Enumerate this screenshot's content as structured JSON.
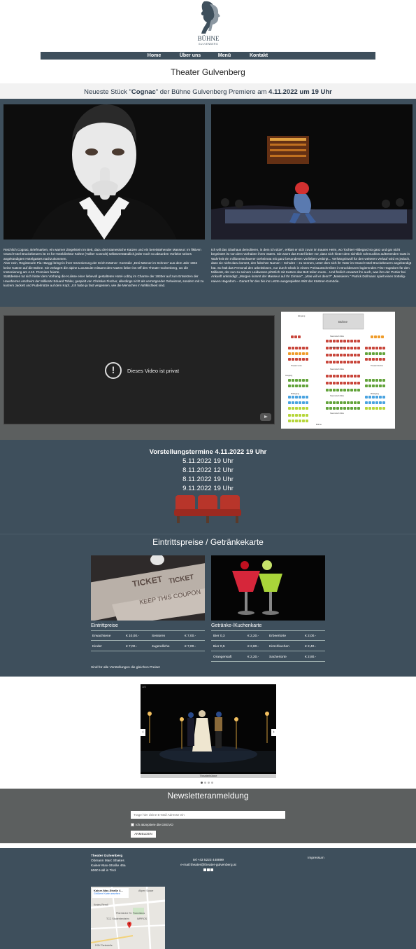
{
  "header": {
    "logo_word": "BÜHNE",
    "logo_sub": "GULVENBERG",
    "nav": [
      "Home",
      "Über uns",
      "Menü",
      "Kontakt"
    ],
    "title": "Theater Gulvenberg",
    "premiere_pre": "Neueste Stück \"",
    "premiere_play": "Cognac",
    "premiere_mid": "\" der Bühne Gulvenberg Premiere am ",
    "premiere_date": "4.11.2022 um 19 Uhr"
  },
  "intro": {
    "left": "Reichlich Cognac, Briefmarken, ein warmer Ziegelstein im Bett, dazu drei siamesische Katzen und ein bereitstehender Masseur: Im fiktiven Grand Hotel Bruckebeuren ist es für Hoteldirektor Kühne (Volker Connolt) selbstverständlich,jeder noch so absurden Vorliebe seines angekündigten Hotelgastes nachzukommen.\nAber nein, Regisseurin Pia Hänggi bringt in ihrer Inszenierung der Erich-Kästner- Komödie „Drei Männer im Schnee\" aus dem Jahr 1934 keine Katzen auf die Bühne. Sie verlagert die alpine Luxussuite mitsamt den Katzen lieber ins Off des Theater Gulvenberg, wo die Inszenierung am 4.10. Premiere feierte.\nStattdessen tut sich hinter dem Vorhang die Kulisse einer liebevoll gestalteten Hotel-Lobby im Charme der 1930er auf zum Entsetzen der Hausherren erscheint der Millionär Eduard Tobler, gespielt von Christian Fischer, allerdings nicht als vermögender Geheimrat, sondern mit zu kurzem Jackett und Pudelmütze auf dem Kopf. „Ich habe ja fast vergessen, wie die Menschen in Wirklichkeit sind.",
    "right": "Ich will das Glashaus demolieren, in dem ich sitze\", erklärt er sich zuvor im trauten Heim, wo Tochter Hildegard so ganz und gar nicht begeistert ist von dem Vorhaben ihres Vaters. Sie warnt das Hotel lieber vor, dass sich hinter dem sichtlich schmucklos auftretenden Gast in Wahrheit ein millionenschwerer Geheimrat mit ganz besonderen Vorlieben verbirgt... Verhängnisvoll für den weiteren Verlauf wird es jedoch, dass sie nicht dazu kommt, den falschen Namen – Schulze – zu nennen, unter dem sich ihr Vater im Grand Hotel Bruckebeuren angekündigt hat. So hält das Personal den arbeitslosen, nur durch Glück in einem Preisausschreiben in Bruckbeuren logierenden Fritz Hagedorn für den Millionär, der nun zu seinem Leidwesen plötzlich mit Katzen das Bett teilen muss... Und freilich erwartet ihn auch, was ihm der Portier bei Ankunft ankündigt: „Morgen kommt der Masseur auf Ihr Zimmer\", „Was will er denn?\" „Massieren.\" Patrick Dollmann spielt einen trottelig-naiven Hagedorn – Garant für den bis ins Letzte ausgespielten Witz der Kästner-Komödie."
  },
  "video": {
    "message": "Dieses Video ist privat"
  },
  "seating": {
    "stage": "Bühne",
    "labels": [
      "Eingang",
      "Stammtisch Mitte",
      "Stammtisch Mitte",
      "Stammtisch Mitte",
      "Stammtisch Mitte",
      "Stammtisch Mitte",
      "Theater Links",
      "Theater Rechts",
      "Mittelgang",
      "Mittelgang",
      "Ausgang",
      "Bühne"
    ]
  },
  "schedule": {
    "title": "Vorstellungstermine 4.11.2022 19 Uhr",
    "dates": [
      "5.11.2022 19 Uhr",
      "8.11.2022 12 Uhr",
      "8.11.2022 19 Uhr",
      "9.11.2022 19 Uhr"
    ]
  },
  "prices": {
    "title": "Eintrittspreise / Getränkekarte",
    "tickets_title": "Eintrittpreise",
    "tickets": [
      [
        "Erwachsene",
        "€ 10,00.-",
        "Senioren",
        "€ 7,00.-"
      ],
      [
        "Kinder",
        "€ 7,00.-",
        "Jugendliche",
        "€ 7,00.-"
      ]
    ],
    "drinks_title": "Getränke-/Kuchenkarte",
    "drinks": [
      [
        "Bier 0,3",
        "€ 2,20.-",
        "Erbeertorte",
        "€ 2,00.-"
      ],
      [
        "Bier 0,5",
        "€ 2,80.-",
        "Kirschkuchen",
        "€ 2,40.-"
      ],
      [
        "Orangensaft",
        "€ 2,20.-",
        "Sachertorte",
        "€ 2,80.-"
      ]
    ],
    "note": "Sind für alle Vorstellungen die gleichen Preise!"
  },
  "gallery": {
    "counter": "1/4",
    "caption": "Theaterbühne",
    "prev": "‹",
    "next": "›"
  },
  "newsletter": {
    "title": "Newsletteranmeldung",
    "placeholder": "Trage hier deine E-Mail Adresse ein",
    "consent": "Ich akzeptiere die DSGVO",
    "button": "ANMELDEN"
  },
  "footer": {
    "name": "Theater Gulvenberg",
    "owner": "Obmann Marc Shakes",
    "street": "Kaiser-Max-Straße 46a",
    "city": "6060 Hall in Tirol",
    "tel": "tel:+43 5223 448899",
    "mail": "e-mail:theater@theater-gulvenberg.at",
    "impressum": "Impressum",
    "map_place": "Kaiser-Max-Straße 4...",
    "map_link": "Größere Karte ansehen",
    "map_labels": [
      "Altpen Space",
      "Kraiss-Rendl",
      "Pfarrkirche St. Franziskus",
      "TCC Studentenheim",
      "IMPROS",
      "DGK Tankstelle"
    ]
  },
  "colors": {
    "band": "#3e4f5c",
    "grey": "#5c5f5f",
    "seat_red": "#c8453a",
    "seat_green": "#62a33a",
    "seat_orange": "#ef9c2a",
    "seat_blue": "#49a3e0",
    "seat_lime": "#b6d63a"
  }
}
